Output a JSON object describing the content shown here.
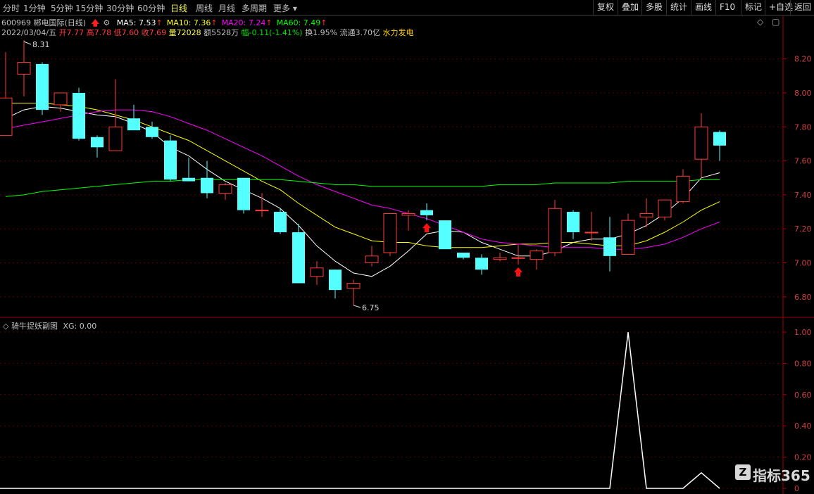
{
  "toolbar": {
    "timeframes": [
      "分时",
      "1分钟",
      "5分钟",
      "15分钟",
      "30分钟",
      "60分钟",
      "日线",
      "周线",
      "月线",
      "多周期",
      "更多"
    ],
    "active": "日线",
    "right_buttons": [
      "复权",
      "叠加",
      "多股",
      "统计",
      "画线",
      "F10",
      "标记",
      "+自选",
      "返回"
    ]
  },
  "stock": {
    "code_name": "600969 郴电国际(日线)",
    "ma_labels": [
      {
        "text": "MA5: 7.53",
        "color": "#ffffff"
      },
      {
        "text": "MA10: 7.36",
        "color": "#ffff00"
      },
      {
        "text": "MA20: 7.24",
        "color": "#ff00ff"
      },
      {
        "text": "MA60: 7.49",
        "color": "#00ff00"
      }
    ],
    "date": "2022/03/04/五",
    "open": "开7.77",
    "high": "高7.78",
    "low": "低7.60",
    "close": "收7.69",
    "volume": "量72028",
    "amount": "额5528万",
    "change": "幅-0.11(-1.41%)",
    "turnover": "换1.95%",
    "float": "流通3.70亿",
    "sector": "水力发电"
  },
  "sub_panel": {
    "title": "骑牛捉妖副图",
    "xg": "XG: 0.00"
  },
  "watermark": {
    "icon": "Z",
    "text": "指标365"
  },
  "chart_data": [
    {
      "type": "candlestick",
      "ylim": [
        6.7,
        8.34
      ],
      "y_ticks": [
        "8.20",
        "8.00",
        "7.80",
        "7.60",
        "7.40",
        "7.20",
        "7.00",
        "6.80"
      ],
      "annotations": {
        "high": "8.31",
        "low": "6.75"
      },
      "candles": [
        {
          "o": 7.75,
          "h": 8.24,
          "l": 7.75,
          "c": 7.97
        },
        {
          "o": 8.11,
          "h": 8.31,
          "l": 7.98,
          "c": 8.18
        },
        {
          "o": 8.17,
          "h": 8.18,
          "l": 7.87,
          "c": 7.9
        },
        {
          "o": 7.93,
          "h": 8.0,
          "l": 7.89,
          "c": 8.0
        },
        {
          "o": 8.0,
          "h": 8.03,
          "l": 7.72,
          "c": 7.73
        },
        {
          "o": 7.74,
          "h": 7.75,
          "l": 7.62,
          "c": 7.68
        },
        {
          "o": 7.66,
          "h": 8.08,
          "l": 7.66,
          "c": 7.8
        },
        {
          "o": 7.85,
          "h": 7.93,
          "l": 7.78,
          "c": 7.78
        },
        {
          "o": 7.8,
          "h": 7.83,
          "l": 7.73,
          "c": 7.74
        },
        {
          "o": 7.72,
          "h": 7.75,
          "l": 7.48,
          "c": 7.49
        },
        {
          "o": 7.5,
          "h": 7.62,
          "l": 7.48,
          "c": 7.48
        },
        {
          "o": 7.5,
          "h": 7.6,
          "l": 7.38,
          "c": 7.41
        },
        {
          "o": 7.41,
          "h": 7.47,
          "l": 7.37,
          "c": 7.46
        },
        {
          "o": 7.5,
          "h": 7.5,
          "l": 7.29,
          "c": 7.31
        },
        {
          "o": 7.31,
          "h": 7.41,
          "l": 7.27,
          "c": 7.31
        },
        {
          "o": 7.3,
          "h": 7.32,
          "l": 7.17,
          "c": 7.18
        },
        {
          "o": 7.18,
          "h": 7.23,
          "l": 6.88,
          "c": 6.88
        },
        {
          "o": 6.92,
          "h": 7.01,
          "l": 6.87,
          "c": 6.97
        },
        {
          "o": 6.96,
          "h": 6.96,
          "l": 6.79,
          "c": 6.84
        },
        {
          "o": 6.85,
          "h": 6.9,
          "l": 6.75,
          "c": 6.88
        },
        {
          "o": 7.0,
          "h": 7.1,
          "l": 6.98,
          "c": 7.04
        },
        {
          "o": 7.06,
          "h": 7.29,
          "l": 7.04,
          "c": 7.29
        },
        {
          "o": 7.28,
          "h": 7.31,
          "l": 7.19,
          "c": 7.29
        },
        {
          "o": 7.31,
          "h": 7.35,
          "l": 7.25,
          "c": 7.28
        },
        {
          "o": 7.25,
          "h": 7.25,
          "l": 7.08,
          "c": 7.08
        },
        {
          "o": 7.06,
          "h": 7.06,
          "l": 7.02,
          "c": 7.03
        },
        {
          "o": 7.03,
          "h": 7.05,
          "l": 6.93,
          "c": 6.96
        },
        {
          "o": 7.02,
          "h": 7.06,
          "l": 7.01,
          "c": 7.03
        },
        {
          "o": 7.03,
          "h": 7.11,
          "l": 6.99,
          "c": 7.03
        },
        {
          "o": 7.02,
          "h": 7.08,
          "l": 6.96,
          "c": 7.07
        },
        {
          "o": 7.06,
          "h": 7.37,
          "l": 7.04,
          "c": 7.32
        },
        {
          "o": 7.3,
          "h": 7.31,
          "l": 7.14,
          "c": 7.18
        },
        {
          "o": 7.18,
          "h": 7.3,
          "l": 7.13,
          "c": 7.18
        },
        {
          "o": 7.15,
          "h": 7.27,
          "l": 6.95,
          "c": 7.04
        },
        {
          "o": 7.05,
          "h": 7.29,
          "l": 7.05,
          "c": 7.25
        },
        {
          "o": 7.27,
          "h": 7.38,
          "l": 7.21,
          "c": 7.29
        },
        {
          "o": 7.27,
          "h": 7.37,
          "l": 7.25,
          "c": 7.37
        },
        {
          "o": 7.36,
          "h": 7.55,
          "l": 7.35,
          "c": 7.51
        },
        {
          "o": 7.61,
          "h": 7.88,
          "l": 7.5,
          "c": 7.8
        },
        {
          "o": 7.77,
          "h": 7.78,
          "l": 7.6,
          "c": 7.69
        }
      ],
      "series": [
        {
          "name": "MA5",
          "color": "#ffffff",
          "values": [
            7.85,
            7.9,
            7.92,
            7.91,
            7.89,
            7.87,
            7.86,
            7.82,
            7.77,
            7.68,
            7.63,
            7.55,
            7.48,
            7.43,
            7.38,
            7.32,
            7.22,
            7.1,
            7.01,
            6.94,
            6.92,
            6.98,
            7.07,
            7.17,
            7.19,
            7.18,
            7.12,
            7.08,
            7.04,
            7.04,
            7.07,
            7.12,
            7.14,
            7.14,
            7.17,
            7.22,
            7.29,
            7.38,
            7.5,
            7.53
          ]
        },
        {
          "name": "MA10",
          "color": "#ffff00",
          "values": [
            7.94,
            7.94,
            7.94,
            7.93,
            7.92,
            7.9,
            7.87,
            7.84,
            7.8,
            7.76,
            7.72,
            7.66,
            7.6,
            7.54,
            7.48,
            7.43,
            7.35,
            7.28,
            7.21,
            7.17,
            7.13,
            7.12,
            7.12,
            7.1,
            7.09,
            7.09,
            7.09,
            7.1,
            7.11,
            7.11,
            7.12,
            7.12,
            7.11,
            7.1,
            7.1,
            7.13,
            7.18,
            7.24,
            7.31,
            7.36
          ]
        },
        {
          "name": "MA20",
          "color": "#ff00ff",
          "values": [
            7.79,
            7.81,
            7.83,
            7.85,
            7.87,
            7.89,
            7.9,
            7.9,
            7.89,
            7.86,
            7.82,
            7.78,
            7.73,
            7.68,
            7.63,
            7.57,
            7.51,
            7.46,
            7.42,
            7.38,
            7.34,
            7.32,
            7.29,
            7.26,
            7.22,
            7.18,
            7.14,
            7.12,
            7.11,
            7.1,
            7.09,
            7.09,
            7.09,
            7.08,
            7.08,
            7.09,
            7.11,
            7.15,
            7.2,
            7.24
          ]
        },
        {
          "name": "MA60",
          "color": "#00ff00",
          "values": [
            7.39,
            7.4,
            7.42,
            7.43,
            7.44,
            7.45,
            7.46,
            7.47,
            7.48,
            7.48,
            7.49,
            7.49,
            7.49,
            7.49,
            7.49,
            7.49,
            7.48,
            7.47,
            7.46,
            7.46,
            7.45,
            7.45,
            7.45,
            7.45,
            7.45,
            7.45,
            7.45,
            7.46,
            7.46,
            7.46,
            7.47,
            7.47,
            7.47,
            7.47,
            7.48,
            7.48,
            7.48,
            7.48,
            7.49,
            7.49
          ]
        }
      ],
      "markers": [
        {
          "index": 23,
          "type": "up-arrow"
        },
        {
          "index": 28,
          "type": "up-arrow"
        }
      ]
    },
    {
      "type": "line",
      "title": "骑牛捉妖副图",
      "ylim": [
        0,
        1.0
      ],
      "y_ticks": [
        "1.00",
        "0.80",
        "0.60",
        "0.40",
        "0.20",
        "0"
      ],
      "series": [
        {
          "name": "XG",
          "color": "#ffffff",
          "values": [
            0,
            0,
            0,
            0,
            0,
            0,
            0,
            0,
            0,
            0,
            0,
            0,
            0,
            0,
            0,
            0,
            0,
            0,
            0,
            0,
            0,
            0,
            0,
            0,
            0,
            0,
            0,
            0,
            0,
            0,
            0,
            0,
            0,
            0,
            1.0,
            0,
            0,
            0,
            0.1,
            0
          ]
        }
      ]
    }
  ]
}
